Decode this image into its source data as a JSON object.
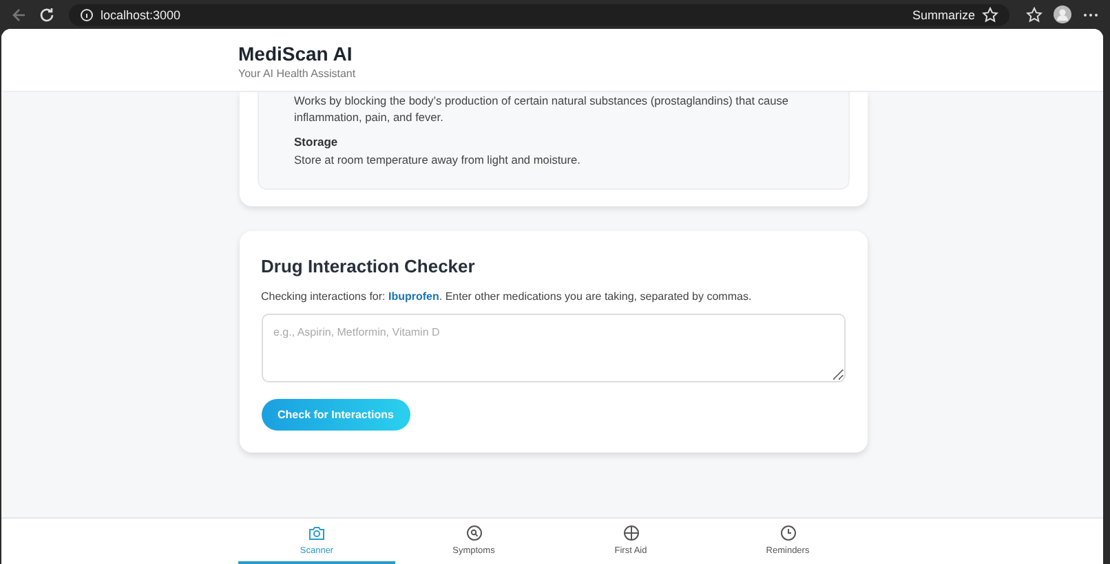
{
  "browser": {
    "url": "localhost:3000",
    "summarize": "Summarize"
  },
  "header": {
    "title": "MediScan AI",
    "subtitle": "Your AI Health Assistant"
  },
  "details": [
    {
      "text": "Works by blocking the body’s production of certain natural substances (prostaglandins) that cause inflammation, pain, and fever."
    },
    {
      "heading": "Storage",
      "text": "Store at room temperature away from light and moisture."
    }
  ],
  "checker": {
    "title": "Drug Interaction Checker",
    "intro": "Checking interactions for: **Ibuprofen**. Enter other medications you are taking, separated by commas.",
    "placeholder": "e.g., Aspirin, Metformin, Vitamin D",
    "button": "Check for Interactions"
  },
  "nav": [
    {
      "label": "Scanner",
      "kind": "camera",
      "selected": true
    },
    {
      "label": "Symptoms",
      "kind": "search",
      "selected": false
    },
    {
      "label": "First Aid",
      "kind": "cross",
      "selected": false
    },
    {
      "label": "Reminders",
      "kind": "clock",
      "selected": false
    }
  ]
}
